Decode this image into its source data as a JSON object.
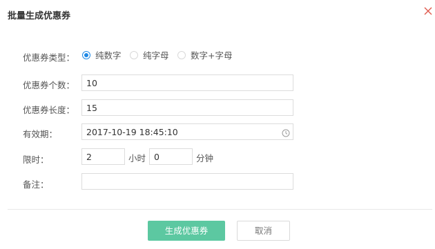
{
  "dialog": {
    "title": "批量生成优惠券"
  },
  "form": {
    "type": {
      "label": "优惠券类型：",
      "options": [
        {
          "label": "纯数字",
          "checked": true
        },
        {
          "label": "纯字母",
          "checked": false
        },
        {
          "label": "数字+字母",
          "checked": false
        }
      ]
    },
    "count": {
      "label": "优惠券个数：",
      "value": "10"
    },
    "length": {
      "label": "优惠券长度：",
      "value": "15"
    },
    "validity": {
      "label": "有效期：",
      "value": "2017-10-19 18:45:10"
    },
    "time_limit": {
      "label": "限时：",
      "hours_value": "2",
      "hours_unit": "小时",
      "minutes_value": "0",
      "minutes_unit": "分钟"
    },
    "remark": {
      "label": "备注：",
      "value": ""
    }
  },
  "buttons": {
    "generate": "生成优惠券",
    "cancel": "取消"
  },
  "colors": {
    "primary_button": "#5cc8a1",
    "radio_accent": "#1e88e5",
    "close_icon": "#e05a4e"
  },
  "icons": {
    "close": "close-icon",
    "clock": "clock-icon"
  }
}
